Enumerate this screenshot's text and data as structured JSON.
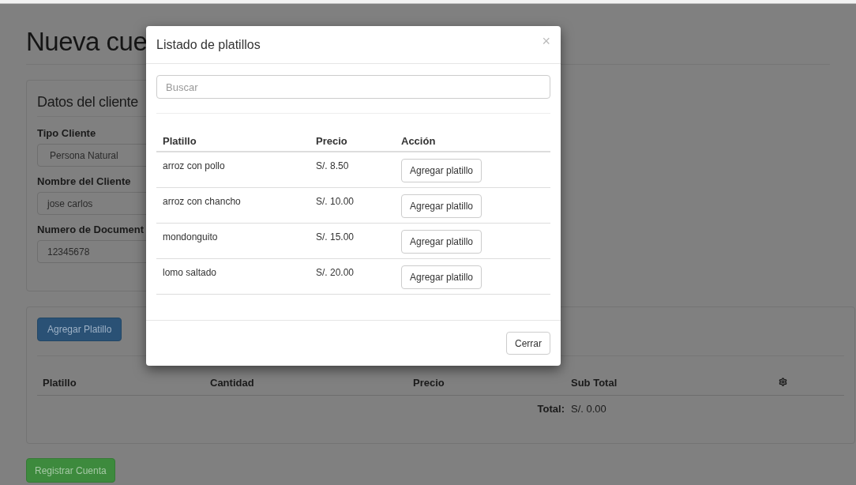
{
  "page": {
    "title": "Nueva cue"
  },
  "client_panel": {
    "title": "Datos del cliente",
    "fields": [
      {
        "label": "Tipo Cliente",
        "value": "Persona Natural",
        "kind": "select"
      },
      {
        "label": "Nombre del Cliente",
        "value": "jose carlos",
        "kind": "text"
      },
      {
        "label": "Numero de Document",
        "value": "12345678",
        "kind": "text"
      }
    ]
  },
  "items_panel": {
    "add_button": "Agregar Platillo",
    "columns": [
      "Platillo",
      "Cantidad",
      "Precio",
      "Sub Total"
    ],
    "total_label": "Total:",
    "total_value": "S/. 0.00"
  },
  "register_button": "Registrar Cuenta",
  "modal": {
    "title": "Listado de platillos",
    "close": "×",
    "search": {
      "placeholder": "Buscar"
    },
    "columns": [
      "Platillo",
      "Precio",
      "Acción"
    ],
    "rows": [
      {
        "name": "arroz con pollo",
        "price": "S/. 8.50",
        "action": "Agregar platillo"
      },
      {
        "name": "arroz con chancho",
        "price": "S/. 10.00",
        "action": "Agregar platillo"
      },
      {
        "name": "mondonguito",
        "price": "S/. 15.00",
        "action": "Agregar platillo"
      },
      {
        "name": "lomo saltado",
        "price": "S/. 20.00",
        "action": "Agregar platillo"
      }
    ],
    "close_button": "Cerrar"
  }
}
